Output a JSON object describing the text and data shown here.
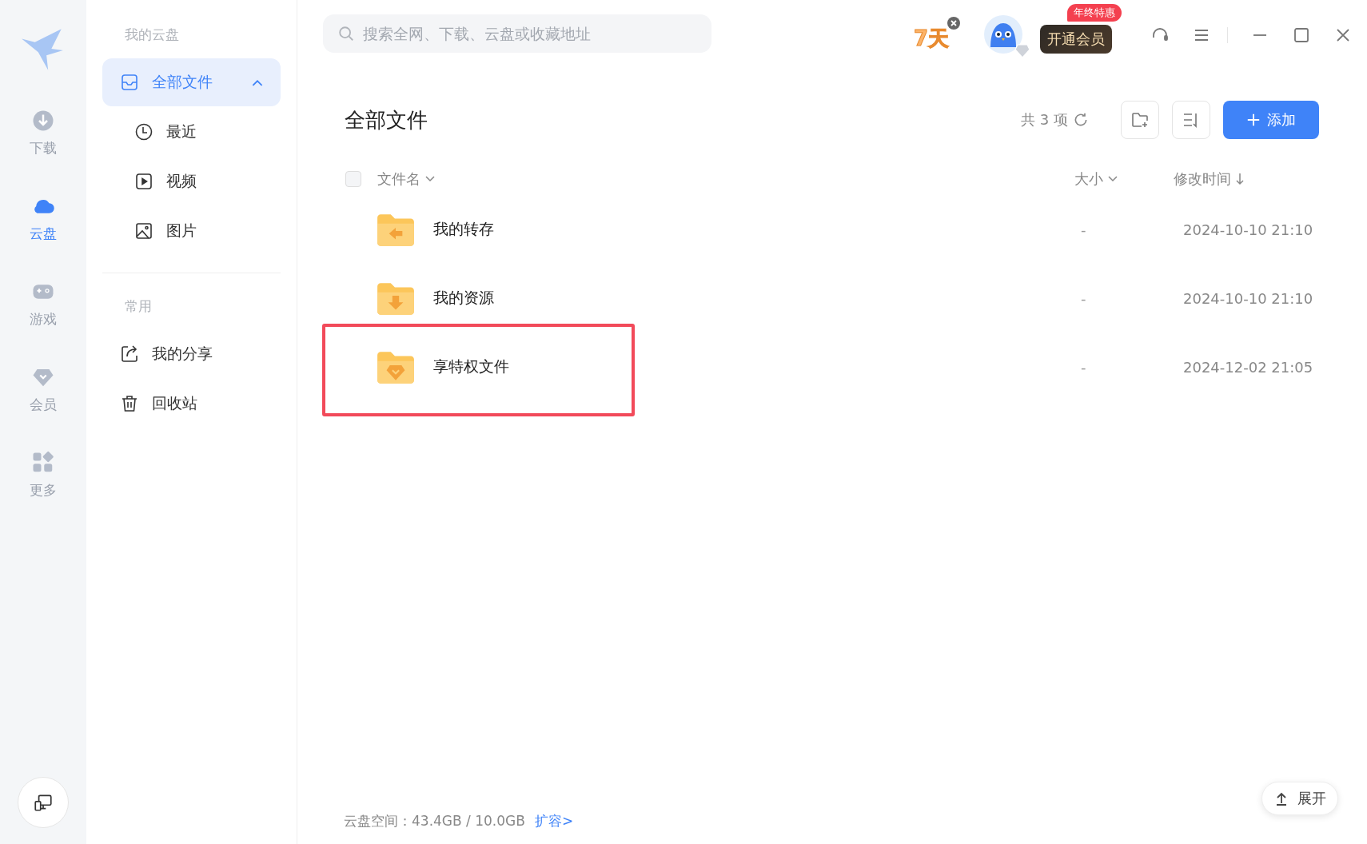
{
  "rail": {
    "items": [
      {
        "label": "下载",
        "kind": "download",
        "selected": false
      },
      {
        "label": "云盘",
        "kind": "cloud",
        "selected": true
      },
      {
        "label": "游戏",
        "kind": "game",
        "selected": false
      },
      {
        "label": "会员",
        "kind": "vip",
        "selected": false
      },
      {
        "label": "更多",
        "kind": "more",
        "selected": false
      }
    ]
  },
  "sidebar": {
    "sections": [
      {
        "title": "我的云盘",
        "items": [
          {
            "label": "全部文件",
            "kind": "inbox",
            "selected": true,
            "expanded": true,
            "children": [
              {
                "label": "最近",
                "kind": "clock",
                "selected": false
              },
              {
                "label": "视频",
                "kind": "video",
                "selected": false
              },
              {
                "label": "图片",
                "kind": "image",
                "selected": false
              }
            ]
          }
        ]
      },
      {
        "title": "常用",
        "items": [
          {
            "label": "我的分享",
            "kind": "share",
            "selected": false
          },
          {
            "label": "回收站",
            "kind": "trash",
            "selected": false
          }
        ]
      }
    ]
  },
  "topbar": {
    "search": {
      "placeholder": "搜索全网、下载、云盘或收藏地址"
    },
    "trial_badge": "7天",
    "vip_button": "开通会员",
    "promo_badge": "年终特惠"
  },
  "content": {
    "title": "全部文件",
    "count": "共 3 项",
    "add_button": "添加",
    "select_all": {
      "checked": false
    },
    "columns": [
      {
        "label": "文件名",
        "sorted": false
      },
      {
        "label": "大小",
        "sorted": false
      },
      {
        "label": "修改时间",
        "sorted": true
      }
    ],
    "rows": [
      {
        "name": "我的转存",
        "kind": "transfer",
        "size": "-",
        "modified": "2024-10-10 21:10",
        "highlighted": false
      },
      {
        "name": "我的资源",
        "kind": "download",
        "size": "-",
        "modified": "2024-10-10 21:10",
        "highlighted": false
      },
      {
        "name": "享特权文件",
        "kind": "premium",
        "size": "-",
        "modified": "2024-12-02 21:05",
        "highlighted": true
      }
    ]
  },
  "footer": {
    "storage": "云盘空间：43.4GB / 10.0GB",
    "expand_link": "扩容>",
    "expand_button": "展开"
  }
}
